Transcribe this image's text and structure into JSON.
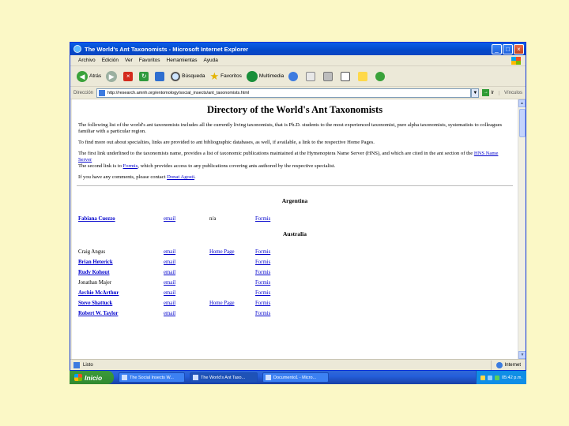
{
  "window": {
    "title": "The World's Ant Taxonomists - Microsoft Internet Explorer",
    "controls": [
      "_",
      "□",
      "×"
    ]
  },
  "menubar": [
    "Archivo",
    "Edición",
    "Ver",
    "Favoritos",
    "Herramientas",
    "Ayuda"
  ],
  "toolbar": {
    "back": "Atrás",
    "search": "Búsqueda",
    "favorites": "Favoritos",
    "media": "Multimedia"
  },
  "address": {
    "label": "Dirección",
    "url": "http://research.amnh.org/entomology/social_insects/ant_taxonomists.html",
    "go": "Ir",
    "links": "Vínculos"
  },
  "page": {
    "title": "Directory of the World's Ant Taxonomists",
    "intro1": "The following list of the world's ant taxonomists includes all the currently living taxonomists, that is Ph.D. students to the most experienced taxonomist, pure alpha taxonomists, systematists to colleagues familiar with a particular region.",
    "intro2": "To find more out about specialties, links are provided to ant bibliographic databases, as well, if available, a link to the respective Home Pages.",
    "intro3_a": "The first link underlined to the taxonomists name, provides a list of taxonomic publications maintained at the Hymenoptera Name Server (HNS), and which are cited in the ant section of the",
    "intro3_link": "HNS Name Server",
    "intro3_b": "The second link is to",
    "intro3_link2": "Formis",
    "intro3_c": ", which provides access to any publications covering ants authored by the respective specialist.",
    "contact_a": "If you have any comments, please contact",
    "contact_link": "Donat Agosti",
    "contact_end": "."
  },
  "sections": [
    {
      "country": "Argentina",
      "rows": [
        {
          "name": "Fabiana Cuezzo",
          "linked": true,
          "email": "email",
          "home": "n/a",
          "home_link": false,
          "formis": "Formis"
        }
      ]
    },
    {
      "country": "Australia",
      "rows": [
        {
          "name": "Craig Angus",
          "linked": false,
          "email": "email",
          "home": "Home Page",
          "home_link": true,
          "formis": "Formis"
        },
        {
          "name": "Brian Heterick",
          "linked": true,
          "email": "email",
          "home": "",
          "home_link": false,
          "formis": "Formis"
        },
        {
          "name": "Rudy Kohout",
          "linked": true,
          "email": "email",
          "home": "",
          "home_link": false,
          "formis": "Formis"
        },
        {
          "name": "Jonathan Majer",
          "linked": false,
          "email": "email",
          "home": "",
          "home_link": false,
          "formis": "Formis"
        },
        {
          "name": "Archie McArthur",
          "linked": true,
          "email": "email",
          "home": "",
          "home_link": false,
          "formis": "Formis"
        },
        {
          "name": "Steve Shattuck",
          "linked": true,
          "email": "email",
          "home": "Home Page",
          "home_link": true,
          "formis": "Formis"
        },
        {
          "name": "Robert W. Taylor",
          "linked": true,
          "email": "email",
          "home": "",
          "home_link": false,
          "formis": "Formis"
        }
      ]
    }
  ],
  "statusbar": {
    "status": "Listo",
    "zone": "Internet"
  },
  "taskbar": {
    "start": "Inicio",
    "tasks": [
      "The Social Insects W...",
      "The World's Ant Taxo...",
      "Documento1 - Micro..."
    ],
    "active_index": 1,
    "clock": "05:42 p.m."
  }
}
